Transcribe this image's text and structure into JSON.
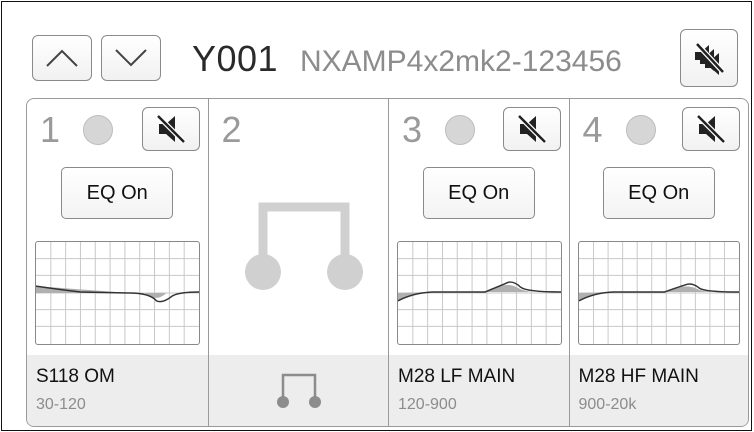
{
  "header": {
    "device_id": "Y001",
    "device_model": "NXAMP4x2mk2-123456",
    "nav_up_icon": "chevron-up-icon",
    "nav_down_icon": "chevron-down-icon",
    "mute_all_icon": "mute-all-icon"
  },
  "channels": [
    {
      "number": "1",
      "led": "off",
      "mute_icon": "speaker-muted-icon",
      "eq_label": "EQ On",
      "preset_name": "S118 OM",
      "preset_range": "30-120"
    },
    {
      "number": "2",
      "linked": true,
      "link_icon": "bridge-link-icon"
    },
    {
      "number": "3",
      "led": "off",
      "mute_icon": "speaker-muted-icon",
      "eq_label": "EQ On",
      "preset_name": "M28 LF MAIN",
      "preset_range": "120-900"
    },
    {
      "number": "4",
      "led": "off",
      "mute_icon": "speaker-muted-icon",
      "eq_label": "EQ On",
      "preset_name": "M28 HF MAIN",
      "preset_range": "900-20k"
    }
  ],
  "colors": {
    "led_off": "#d6d6d6",
    "eq_curve": "#333333",
    "eq_fill": "#b0b0b0",
    "grid": "#c8c8c8",
    "footer_bg": "#ededed",
    "link_line": "#d0d0d0"
  }
}
